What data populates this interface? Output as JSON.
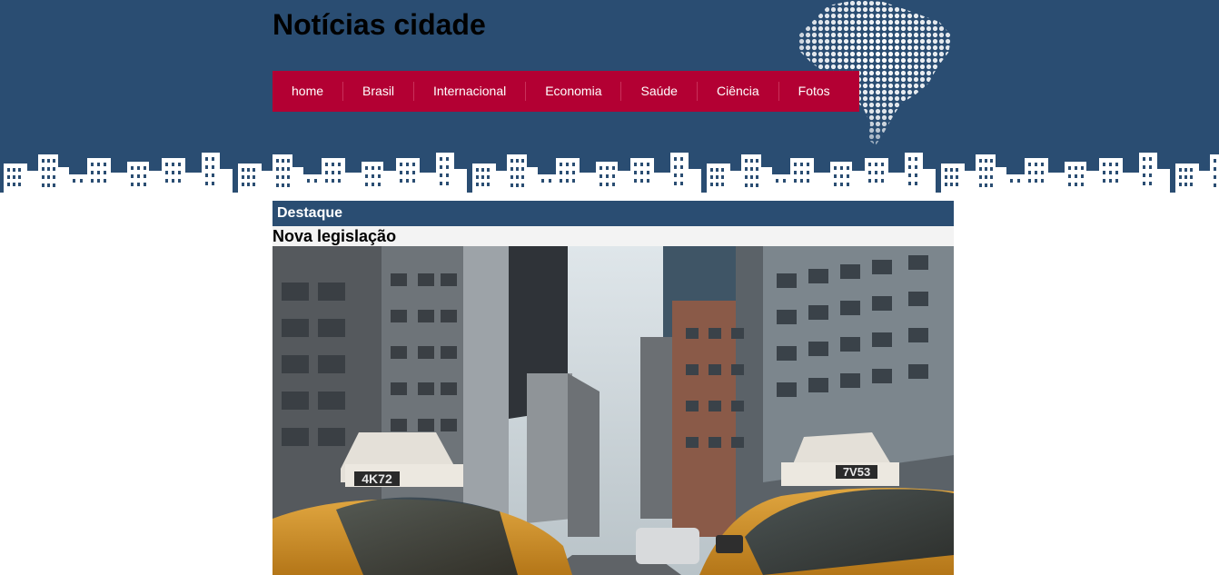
{
  "header": {
    "site_title": "Notícias cidade",
    "map_icon": "brazil-map-dots",
    "skyline_icon": "city-skyline"
  },
  "nav": {
    "items": [
      {
        "label": "home"
      },
      {
        "label": "Brasil"
      },
      {
        "label": "Internacional"
      },
      {
        "label": "Economia"
      },
      {
        "label": "Saúde"
      },
      {
        "label": "Ciência"
      },
      {
        "label": "Fotos"
      }
    ]
  },
  "main": {
    "section_label": "Destaque",
    "article_title": "Nova legislação",
    "photo": {
      "taxi_left_number": "4K72",
      "taxi_right_number": "7V53"
    }
  },
  "colors": {
    "header_bg": "#2a4d72",
    "nav_bg": "#b30033",
    "title_bg": "#f3f3f3"
  }
}
